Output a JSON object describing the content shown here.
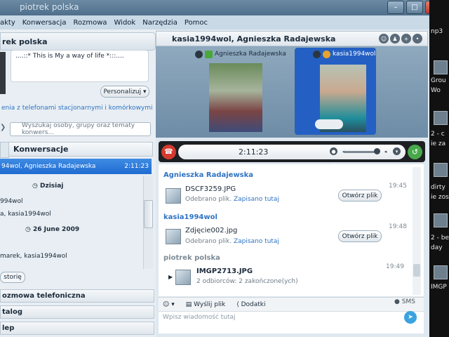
{
  "window": {
    "title": "piotrek polska"
  },
  "menu": [
    "akty",
    "Konwersacja",
    "Rozmowa",
    "Widok",
    "Narzędzia",
    "Pomoc"
  ],
  "left": {
    "profile_name": "rek polska",
    "mood": "....::* This is My a way of life *:::....",
    "personalize_label": "Personalizuj",
    "phone_link": "enia z telefonami stacjonarnymi i komórkowymi",
    "search_placeholder": "Wyszukaj osoby, grupy oraz tematy konwers...",
    "conversations_header": "Konwersacje",
    "selected": {
      "name": "94wol, Agnieszka Radajewska",
      "time": "2:11:23"
    },
    "list": [
      {
        "type": "date",
        "text": "Dzisiaj"
      },
      {
        "type": "item",
        "text": "994wol"
      },
      {
        "type": "item",
        "text": "a, kasia1994wol"
      },
      {
        "type": "date",
        "text": "26 June 2009"
      },
      {
        "type": "item",
        "text": "marek, kasia1994wol"
      }
    ],
    "history_label": "storię",
    "sections": [
      "ozmowa telefoniczna",
      "talog",
      "lep"
    ]
  },
  "chat": {
    "title": "kasia1994wol, Agnieszka Radajewska",
    "participant1": "Agnieszka Radajewska",
    "participant2": "kasia1994wol",
    "timer": "2:11:23",
    "messages": [
      {
        "sender": "Agnieszka Radajewska",
        "file": "DSCF3259.JPG",
        "status": "Odebrano plik.",
        "link": "Zapisano tutaj",
        "button": "Otwórz plik",
        "time": "19:45"
      },
      {
        "sender": "kasia1994wol",
        "file": "Zdjęcie002.jpg",
        "status": "Odebrano plik.",
        "link": "Zapisano tutaj",
        "button": "Otwórz plik",
        "time": "19:48"
      },
      {
        "sender": "piotrek polska",
        "file": "IMGP2713.JPG",
        "status": "2 odbiorców: 2 zakończone(ych)",
        "link": "",
        "button": "",
        "time": "19:49"
      }
    ],
    "toolbar": {
      "send_file": "Wyślij plik",
      "extras": "Dodatki",
      "sms": "SMS"
    },
    "input_placeholder": "Wpisz wiadomość tutaj"
  },
  "desktop": [
    "np3",
    "Grou",
    "Wo",
    "2 - c",
    "ie za",
    "dirty",
    "ie zos",
    "2 - be",
    "day",
    "IMGP"
  ],
  "colors": {
    "accent": "#1f6bd1",
    "link": "#2f73c3",
    "hangup": "#d43a2f",
    "call": "#49a84b"
  }
}
